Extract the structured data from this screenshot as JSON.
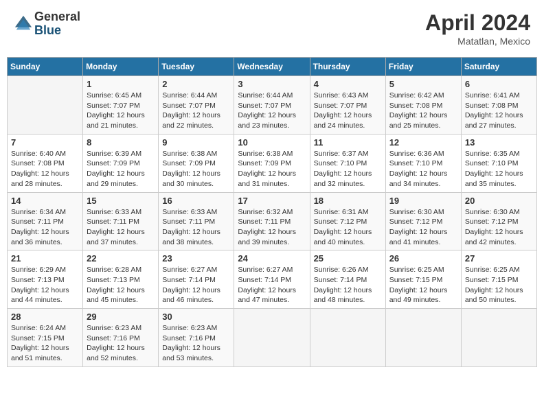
{
  "logo": {
    "general": "General",
    "blue": "Blue"
  },
  "title": {
    "month_year": "April 2024",
    "location": "Matatlan, Mexico"
  },
  "days_of_week": [
    "Sunday",
    "Monday",
    "Tuesday",
    "Wednesday",
    "Thursday",
    "Friday",
    "Saturday"
  ],
  "weeks": [
    [
      {
        "day": "",
        "info": ""
      },
      {
        "day": "1",
        "sunrise": "6:45 AM",
        "sunset": "7:07 PM",
        "daylight": "12 hours and 21 minutes."
      },
      {
        "day": "2",
        "sunrise": "6:44 AM",
        "sunset": "7:07 PM",
        "daylight": "12 hours and 22 minutes."
      },
      {
        "day": "3",
        "sunrise": "6:44 AM",
        "sunset": "7:07 PM",
        "daylight": "12 hours and 23 minutes."
      },
      {
        "day": "4",
        "sunrise": "6:43 AM",
        "sunset": "7:07 PM",
        "daylight": "12 hours and 24 minutes."
      },
      {
        "day": "5",
        "sunrise": "6:42 AM",
        "sunset": "7:08 PM",
        "daylight": "12 hours and 25 minutes."
      },
      {
        "day": "6",
        "sunrise": "6:41 AM",
        "sunset": "7:08 PM",
        "daylight": "12 hours and 27 minutes."
      }
    ],
    [
      {
        "day": "7",
        "sunrise": "6:40 AM",
        "sunset": "7:08 PM",
        "daylight": "12 hours and 28 minutes."
      },
      {
        "day": "8",
        "sunrise": "6:39 AM",
        "sunset": "7:09 PM",
        "daylight": "12 hours and 29 minutes."
      },
      {
        "day": "9",
        "sunrise": "6:38 AM",
        "sunset": "7:09 PM",
        "daylight": "12 hours and 30 minutes."
      },
      {
        "day": "10",
        "sunrise": "6:38 AM",
        "sunset": "7:09 PM",
        "daylight": "12 hours and 31 minutes."
      },
      {
        "day": "11",
        "sunrise": "6:37 AM",
        "sunset": "7:10 PM",
        "daylight": "12 hours and 32 minutes."
      },
      {
        "day": "12",
        "sunrise": "6:36 AM",
        "sunset": "7:10 PM",
        "daylight": "12 hours and 34 minutes."
      },
      {
        "day": "13",
        "sunrise": "6:35 AM",
        "sunset": "7:10 PM",
        "daylight": "12 hours and 35 minutes."
      }
    ],
    [
      {
        "day": "14",
        "sunrise": "6:34 AM",
        "sunset": "7:11 PM",
        "daylight": "12 hours and 36 minutes."
      },
      {
        "day": "15",
        "sunrise": "6:33 AM",
        "sunset": "7:11 PM",
        "daylight": "12 hours and 37 minutes."
      },
      {
        "day": "16",
        "sunrise": "6:33 AM",
        "sunset": "7:11 PM",
        "daylight": "12 hours and 38 minutes."
      },
      {
        "day": "17",
        "sunrise": "6:32 AM",
        "sunset": "7:11 PM",
        "daylight": "12 hours and 39 minutes."
      },
      {
        "day": "18",
        "sunrise": "6:31 AM",
        "sunset": "7:12 PM",
        "daylight": "12 hours and 40 minutes."
      },
      {
        "day": "19",
        "sunrise": "6:30 AM",
        "sunset": "7:12 PM",
        "daylight": "12 hours and 41 minutes."
      },
      {
        "day": "20",
        "sunrise": "6:30 AM",
        "sunset": "7:12 PM",
        "daylight": "12 hours and 42 minutes."
      }
    ],
    [
      {
        "day": "21",
        "sunrise": "6:29 AM",
        "sunset": "7:13 PM",
        "daylight": "12 hours and 44 minutes."
      },
      {
        "day": "22",
        "sunrise": "6:28 AM",
        "sunset": "7:13 PM",
        "daylight": "12 hours and 45 minutes."
      },
      {
        "day": "23",
        "sunrise": "6:27 AM",
        "sunset": "7:14 PM",
        "daylight": "12 hours and 46 minutes."
      },
      {
        "day": "24",
        "sunrise": "6:27 AM",
        "sunset": "7:14 PM",
        "daylight": "12 hours and 47 minutes."
      },
      {
        "day": "25",
        "sunrise": "6:26 AM",
        "sunset": "7:14 PM",
        "daylight": "12 hours and 48 minutes."
      },
      {
        "day": "26",
        "sunrise": "6:25 AM",
        "sunset": "7:15 PM",
        "daylight": "12 hours and 49 minutes."
      },
      {
        "day": "27",
        "sunrise": "6:25 AM",
        "sunset": "7:15 PM",
        "daylight": "12 hours and 50 minutes."
      }
    ],
    [
      {
        "day": "28",
        "sunrise": "6:24 AM",
        "sunset": "7:15 PM",
        "daylight": "12 hours and 51 minutes."
      },
      {
        "day": "29",
        "sunrise": "6:23 AM",
        "sunset": "7:16 PM",
        "daylight": "12 hours and 52 minutes."
      },
      {
        "day": "30",
        "sunrise": "6:23 AM",
        "sunset": "7:16 PM",
        "daylight": "12 hours and 53 minutes."
      },
      {
        "day": "",
        "info": ""
      },
      {
        "day": "",
        "info": ""
      },
      {
        "day": "",
        "info": ""
      },
      {
        "day": "",
        "info": ""
      }
    ]
  ],
  "labels": {
    "sunrise": "Sunrise:",
    "sunset": "Sunset:",
    "daylight": "Daylight:"
  }
}
